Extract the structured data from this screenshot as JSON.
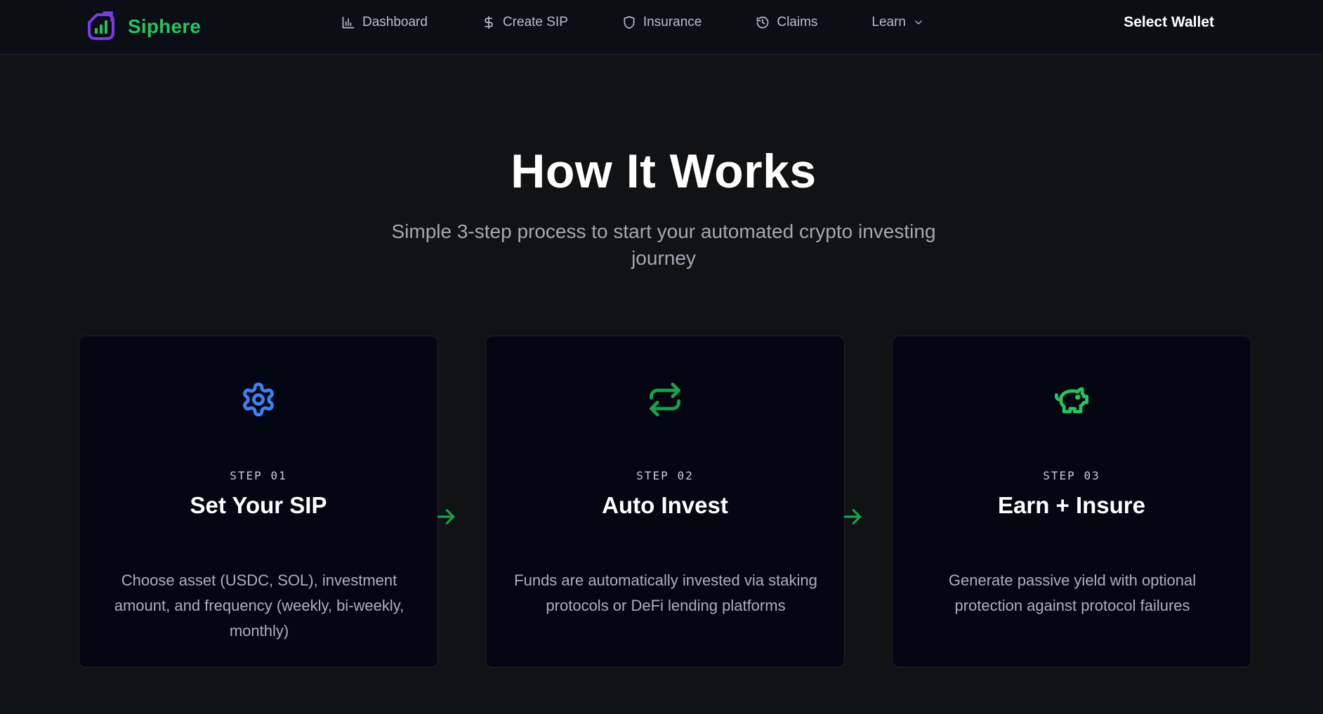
{
  "navbar": {
    "brand_name": "Siphere",
    "items": [
      {
        "label": "Dashboard",
        "icon": "bar-chart-icon"
      },
      {
        "label": "Create SIP",
        "icon": "dollar-icon"
      },
      {
        "label": "Insurance",
        "icon": "shield-icon"
      },
      {
        "label": "Claims",
        "icon": "history-icon"
      },
      {
        "label": "Learn",
        "icon": "chevron-down-icon"
      }
    ],
    "wallet_button": "Select Wallet"
  },
  "hero": {
    "title": "How It Works",
    "subtitle": "Simple 3-step process to start your automated crypto investing journey"
  },
  "steps": [
    {
      "step": "STEP 01",
      "title": "Set Your SIP",
      "description": "Choose asset (USDC, SOL), investment amount, and frequency (weekly, bi-weekly, monthly)",
      "icon": "gear-icon",
      "icon_color": "#3b82f6"
    },
    {
      "step": "STEP 02",
      "title": "Auto Invest",
      "description": "Funds are automatically invested via staking protocols or DeFi lending platforms",
      "icon": "repeat-icon",
      "icon_color": "#16a34a"
    },
    {
      "step": "STEP 03",
      "title": "Earn + Insure",
      "description": "Generate passive yield with optional protection against protocol failures",
      "icon": "piggy-bank-icon",
      "icon_color": "#22c55e"
    }
  ],
  "colors": {
    "brand": "#22c55e",
    "logo_accent": "#7c3aed",
    "background": "#111214",
    "card_background": "#040711",
    "connector_arrow": "#16a34a"
  }
}
